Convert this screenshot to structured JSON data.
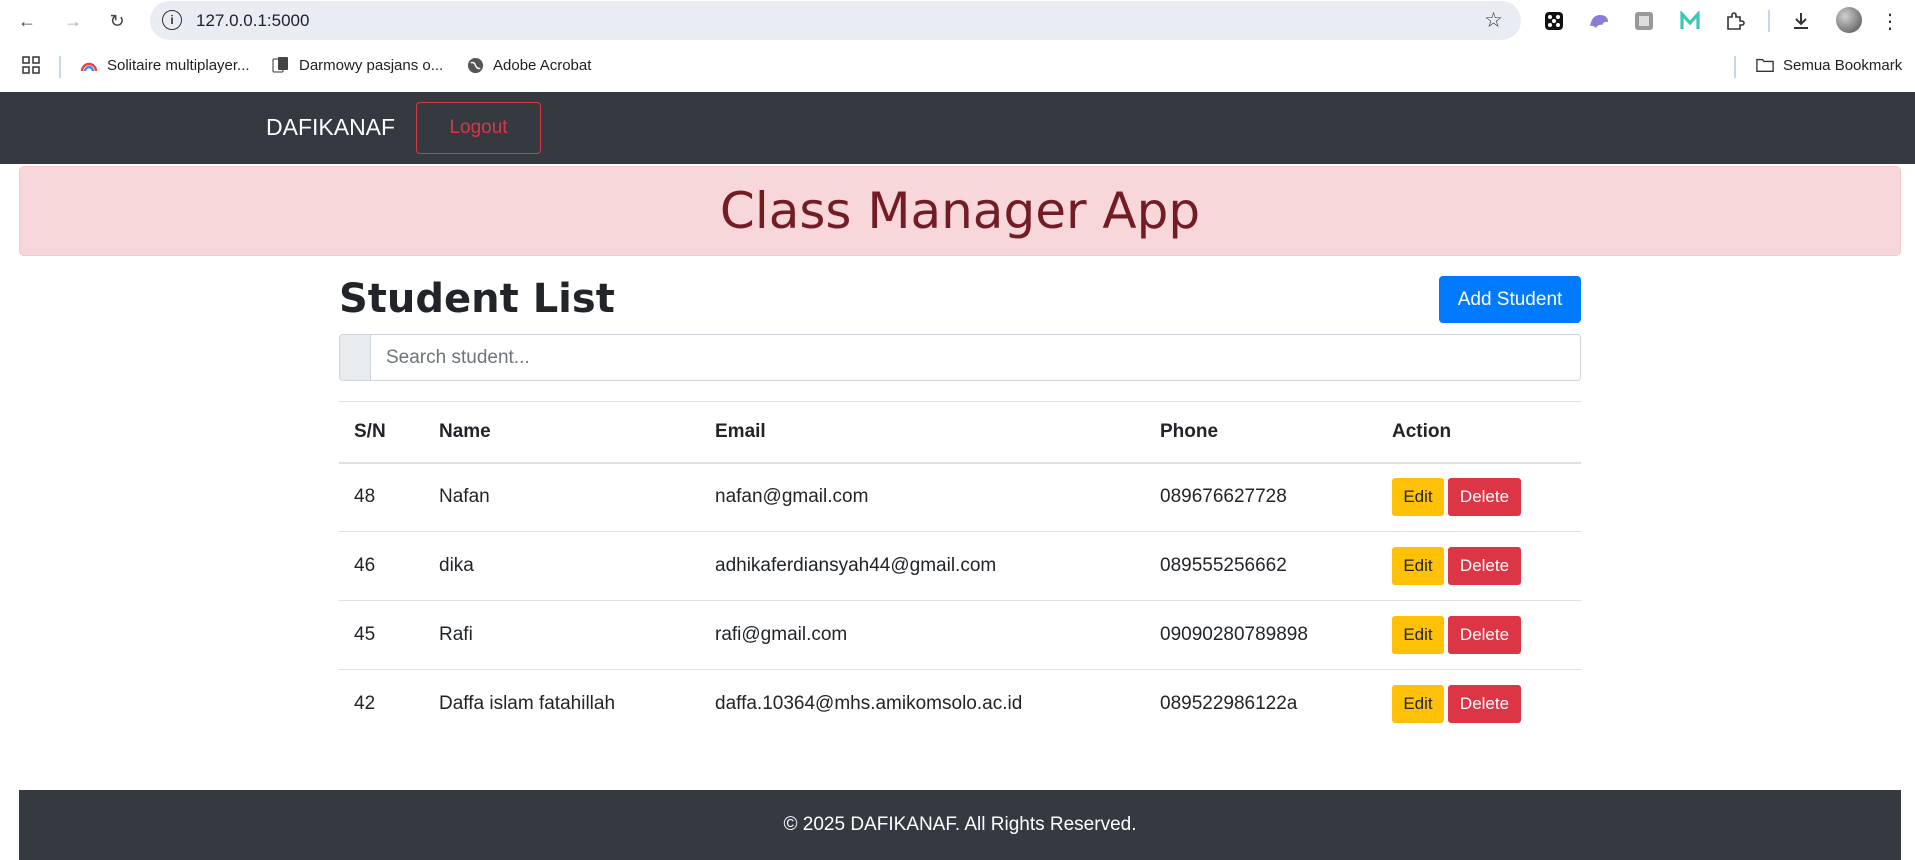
{
  "browser": {
    "url": "127.0.0.1:5000",
    "bookmarks": [
      {
        "label": "Solitaire multiplayer..."
      },
      {
        "label": "Darmowy pasjans o..."
      },
      {
        "label": "Adobe Acrobat"
      }
    ],
    "all_bookmarks_label": "Semua Bookmark"
  },
  "navbar": {
    "brand": "DAFIKANAF",
    "logout_label": "Logout"
  },
  "header": {
    "title": "Class Manager App"
  },
  "main": {
    "title": "Student List",
    "add_label": "Add Student",
    "search_placeholder": "Search student...",
    "columns": [
      "S/N",
      "Name",
      "Email",
      "Phone",
      "Action"
    ],
    "rows": [
      {
        "sn": "48",
        "name": "Nafan",
        "email": "nafan@gmail.com",
        "phone": "089676627728",
        "edit": "Edit",
        "delete": "Delete"
      },
      {
        "sn": "46",
        "name": "dika",
        "email": "adhikaferdiansyah44@gmail.com",
        "phone": "089555256662",
        "edit": "Edit",
        "delete": "Delete"
      },
      {
        "sn": "45",
        "name": "Rafi",
        "email": "rafi@gmail.com",
        "phone": "09090280789898",
        "edit": "Edit",
        "delete": "Delete"
      },
      {
        "sn": "42",
        "name": "Daffa islam fatahillah",
        "email": "daffa.10364@mhs.amikomsolo.ac.id",
        "phone": "089522986122a",
        "edit": "Edit",
        "delete": "Delete"
      }
    ]
  },
  "footer": {
    "text": "© 2025 DAFIKANAF. All Rights Reserved."
  },
  "colors": {
    "navbar": "#343a40",
    "alert_bg": "#f8d7da",
    "alert_text": "#721c24",
    "primary": "#007bff",
    "warning": "#ffc107",
    "danger": "#dc3545"
  }
}
